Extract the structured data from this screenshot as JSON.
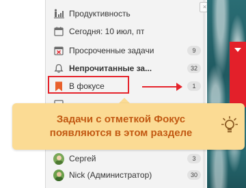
{
  "sidebar": {
    "items": [
      {
        "label": "Продуктивность",
        "badge": "",
        "icon": "productivity-icon"
      },
      {
        "label": "Сегодня: 10 июл, пт",
        "badge": "",
        "icon": "calendar-icon"
      },
      {
        "label": "Просроченные задачи",
        "badge": "9",
        "icon": "overdue-calendar-icon"
      },
      {
        "label": "Непрочитанные за...",
        "badge": "32",
        "icon": "bell-icon"
      },
      {
        "label": "В фокусе",
        "badge": "1",
        "icon": "bookmark-icon"
      },
      {
        "label": "Сергей",
        "badge": "3",
        "icon": "avatar-icon"
      },
      {
        "label": "Nick (Администратор)",
        "badge": "30",
        "icon": "avatar-icon"
      }
    ]
  },
  "tooltip": {
    "text": "Задачи с отметкой Фокус появляются в этом разделе",
    "icon": "lightbulb-icon"
  },
  "colors": {
    "accent": "#e5232b",
    "tooltip_bg": "#fbdb94",
    "tooltip_text": "#c25912",
    "focus_bookmark": "#e8602c"
  }
}
